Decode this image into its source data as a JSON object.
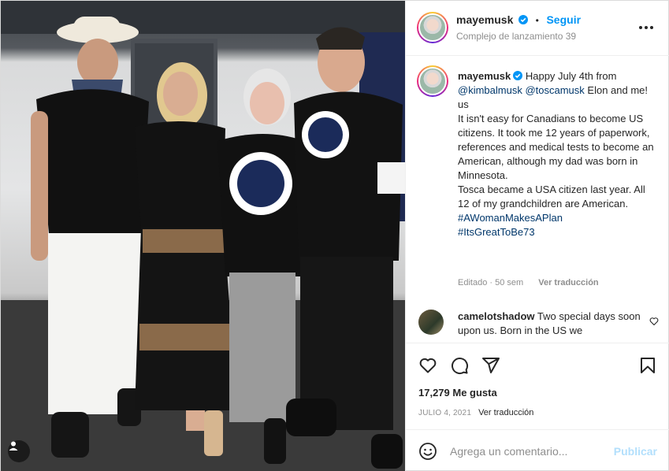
{
  "photo": {
    "alt_icon": "user-tag-icon"
  },
  "header": {
    "username": "mayemusk",
    "separator": "•",
    "follow_label": "Seguir",
    "location": "Complejo de lanzamiento 39",
    "more_icon": "more-options-icon"
  },
  "caption": {
    "username": "mayemusk",
    "intro": "Happy July 4th from",
    "mention_1": "@kimbalmusk",
    "mention_2": "@toscamusk",
    "after_mentions": "Elon and me! us",
    "line_1": "It isn't easy for Canadians to become US citizens. It took me 12 years of paperwork, references and medical tests to become an American, although my dad was born in Minnesota.",
    "line_2": "Tosca became a USA citizen last year. All 12 of my grandchildren are American.",
    "hashtag_1": "#AWomanMakesAPlan",
    "hashtag_2": "#ItsGreatToBe73",
    "edited": "Editado · 50 sem",
    "translate": "Ver traducción"
  },
  "comment": {
    "username": "camelotshadow",
    "text": "Two special days soon upon us. Born in the US we"
  },
  "actions": {
    "like_icon": "heart-icon",
    "comment_icon": "comment-icon",
    "share_icon": "share-icon",
    "save_icon": "bookmark-icon"
  },
  "likes": "17,279 Me gusta",
  "date": "JULIO 4, 2021",
  "date_translate": "Ver traducción",
  "composer": {
    "emoji_icon": "emoji-icon",
    "placeholder": "Agrega un comentario...",
    "post_label": "Publicar"
  },
  "colors": {
    "accent": "#0095f6",
    "link": "#00376b",
    "muted": "#8e8e8e",
    "post_disabled": "#b2dffc"
  }
}
